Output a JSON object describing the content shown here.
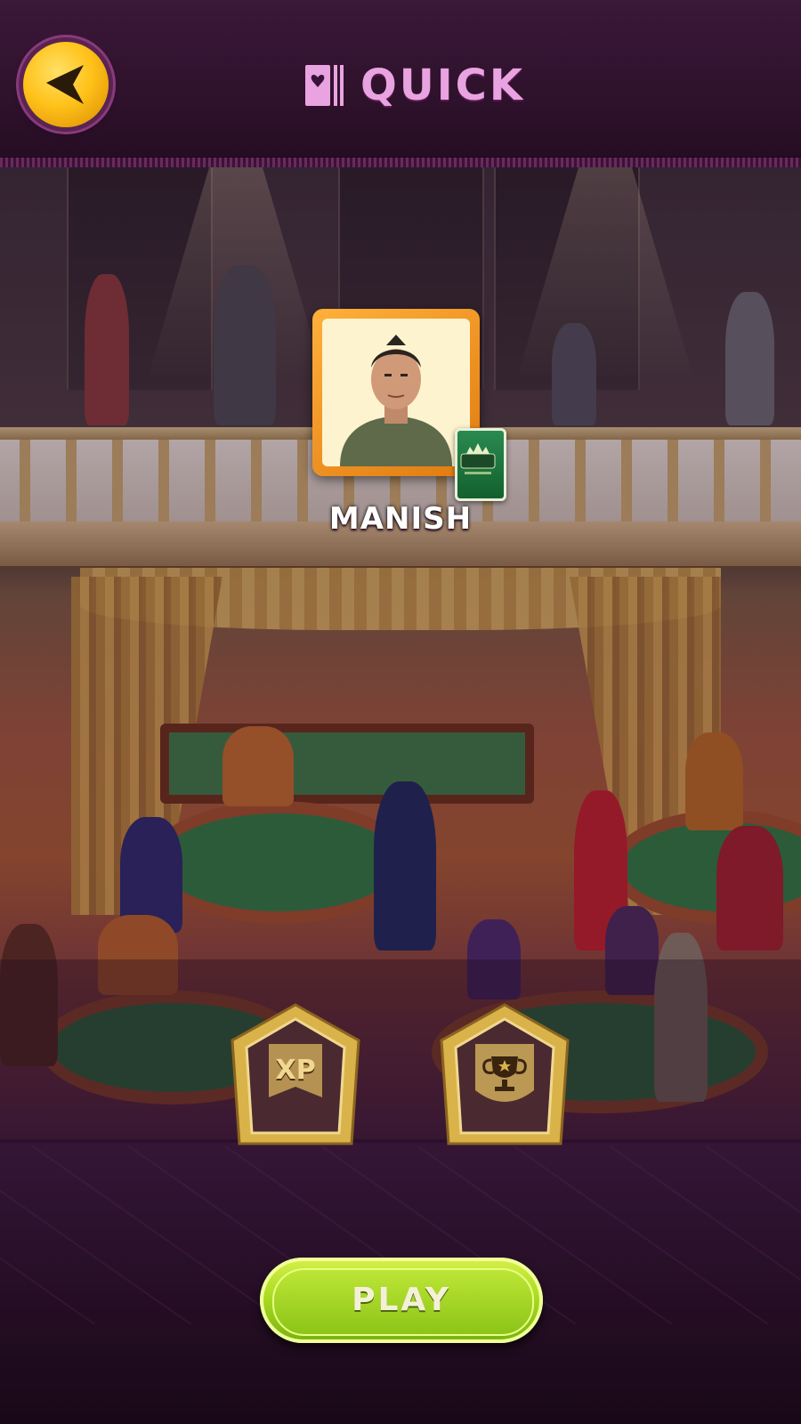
{
  "header": {
    "title": "QUICK",
    "back_icon": "back-arrow-icon",
    "title_icon": "card-deck-icon"
  },
  "player": {
    "name": "MANISH",
    "badge_label": "MASTERS"
  },
  "rewards": [
    {
      "label": "XP",
      "icon": "xp-shield-icon"
    },
    {
      "label": "",
      "icon": "trophy-shield-icon"
    }
  ],
  "actions": {
    "play_label": "PLAY"
  },
  "colors": {
    "title": "#e9a3e0",
    "header_bg": "#2c1029",
    "back_button": "#ffc21a",
    "avatar_frame": "#f29420",
    "play_button": "#a8d820",
    "shield_gold": "#d9b24a"
  }
}
